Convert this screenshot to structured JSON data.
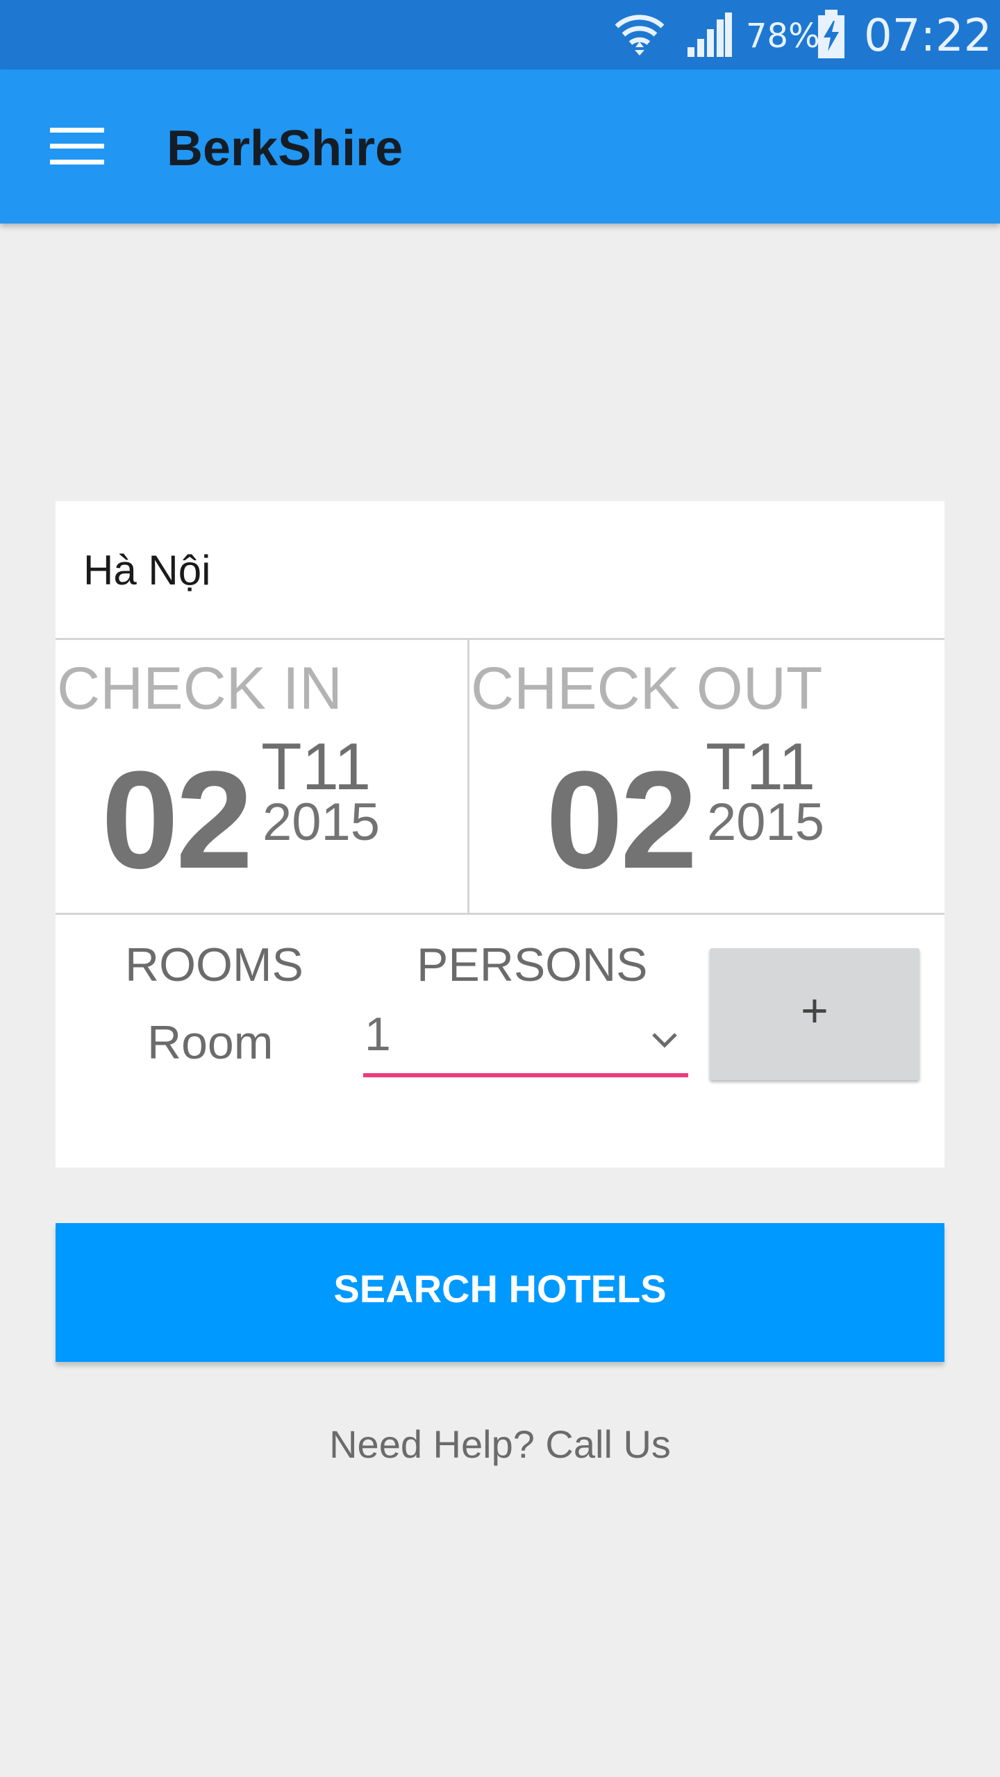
{
  "status_bar": {
    "battery_percent": "78%",
    "time": "07:22",
    "icons": [
      "wifi-icon",
      "signal-icon",
      "battery-charging-icon"
    ]
  },
  "app_bar": {
    "title": "BerkShire",
    "menu_icon": "hamburger-menu-icon"
  },
  "search_form": {
    "destination": "Hà Nội",
    "check_in": {
      "label": "CHECK IN",
      "day": "02",
      "month": "T11",
      "year": "2015"
    },
    "check_out": {
      "label": "CHECK OUT",
      "day": "02",
      "month": "T11",
      "year": "2015"
    },
    "rooms_label": "ROOMS",
    "room_value": "Room",
    "persons_label": "PERSONS",
    "persons_value": "1",
    "add_label": "+"
  },
  "search_button_label": "SEARCH HOTELS",
  "help_text": "Need Help? Call Us",
  "colors": {
    "status_bar": "#1e78d2",
    "app_bar": "#2196f3",
    "search_button": "#0099ff",
    "select_underline": "#ee3b7d",
    "background": "#eeeeee"
  }
}
